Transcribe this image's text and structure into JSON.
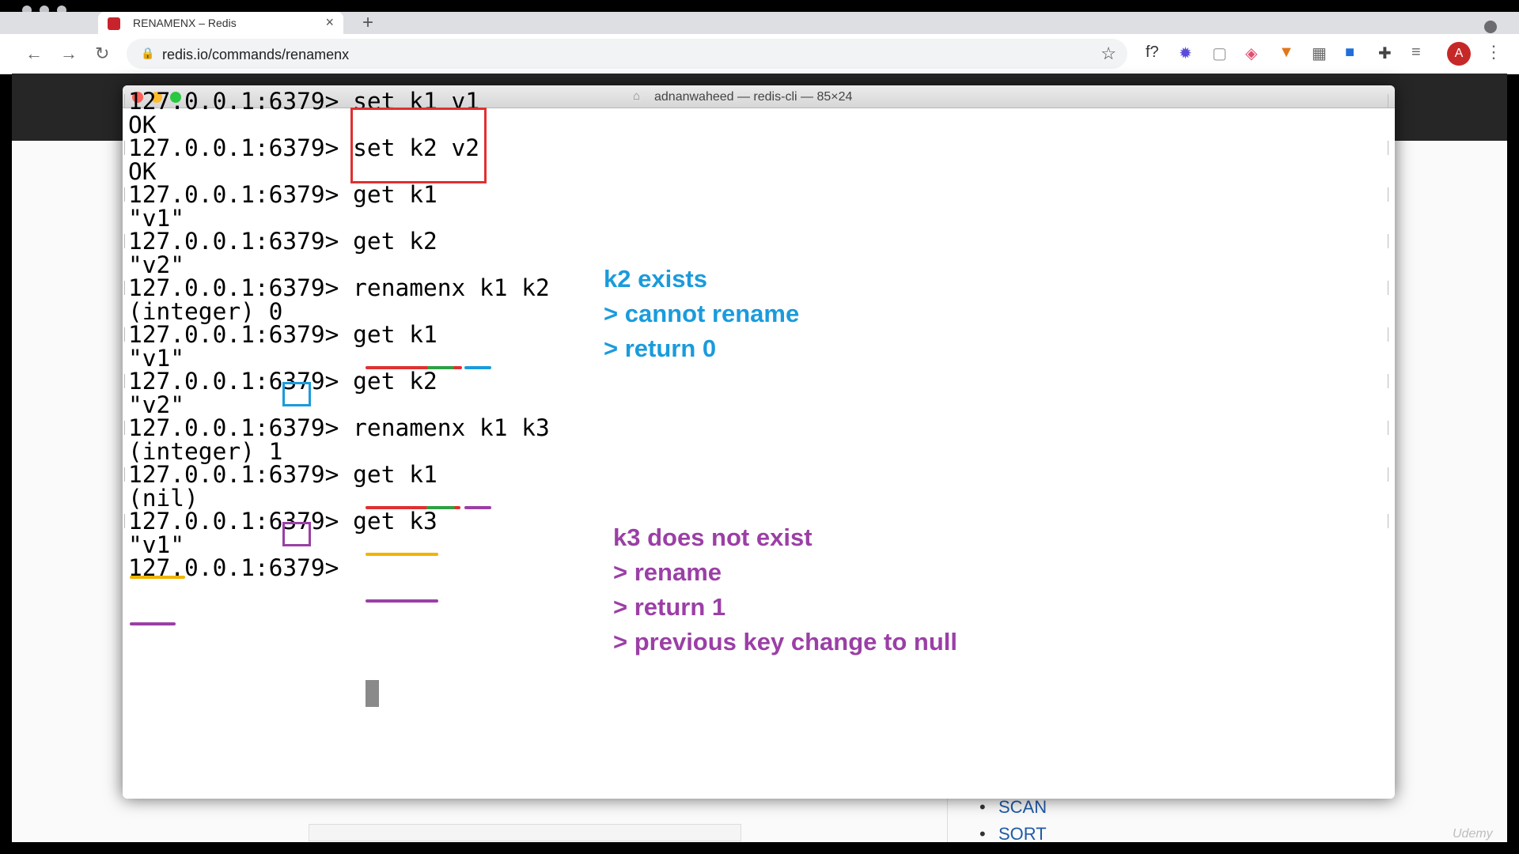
{
  "browser": {
    "tab_title": "RENAMENX – Redis",
    "tab_close": "×",
    "new_tab": "+",
    "url": "redis.io/commands/renamenx",
    "nav": {
      "back": "←",
      "forward": "→",
      "reload": "↻"
    },
    "lock": "🔒",
    "star": "☆",
    "extensions": [
      {
        "icon": "function-icon",
        "glyph": "f?",
        "color": "#333333"
      },
      {
        "icon": "gear-extension-icon",
        "glyph": "✹",
        "color": "#5b4bdb"
      },
      {
        "icon": "square-extension-icon",
        "glyph": "▢",
        "color": "#999999"
      },
      {
        "icon": "badge-extension-icon",
        "glyph": "◈",
        "color": "#e0506e"
      },
      {
        "icon": "fox-extension-icon",
        "glyph": "▼",
        "color": "#e2761b"
      },
      {
        "icon": "grid-extension-icon",
        "glyph": "▦",
        "color": "#666666"
      },
      {
        "icon": "book-extension-icon",
        "glyph": "■",
        "color": "#1e6fd9"
      },
      {
        "icon": "puzzle-icon",
        "glyph": "✚",
        "color": "#444444"
      },
      {
        "icon": "reading-list-icon",
        "glyph": "≡",
        "color": "#666666"
      }
    ],
    "avatar_initial": "A",
    "menu": "⋮"
  },
  "terminal": {
    "title": "adnanwaheed — redis-cli — 85×24",
    "home_icon": "⌂",
    "lines": [
      "127.0.0.1:6379> set k1 v1",
      "OK",
      "127.0.0.1:6379> set k2 v2",
      "OK",
      "127.0.0.1:6379> get k1",
      "\"v1\"",
      "127.0.0.1:6379> get k2",
      "\"v2\"",
      "127.0.0.1:6379> renamenx k1 k2",
      "(integer) 0",
      "127.0.0.1:6379> get k1",
      "\"v1\"",
      "127.0.0.1:6379> get k2",
      "\"v2\"",
      "127.0.0.1:6379> renamenx k1 k3",
      "(integer) 1",
      "127.0.0.1:6379> get k1",
      "(nil)",
      "127.0.0.1:6379> get k3",
      "\"v1\"",
      "127.0.0.1:6379> "
    ]
  },
  "annotations": {
    "blue": [
      "k2 exists",
      "> cannot rename",
      "> return 0"
    ],
    "purple": [
      "k3 does not exist",
      "> rename",
      "> return 1",
      "> previous key change to null"
    ]
  },
  "colors": {
    "blue": "#1a9bdc",
    "purple": "#9b3fa6",
    "red": "#e03030",
    "green": "#2ea043",
    "yellow": "#f0b400"
  },
  "background_page": {
    "list": [
      "SCAN",
      "SORT"
    ]
  },
  "watermark": "Udemy"
}
